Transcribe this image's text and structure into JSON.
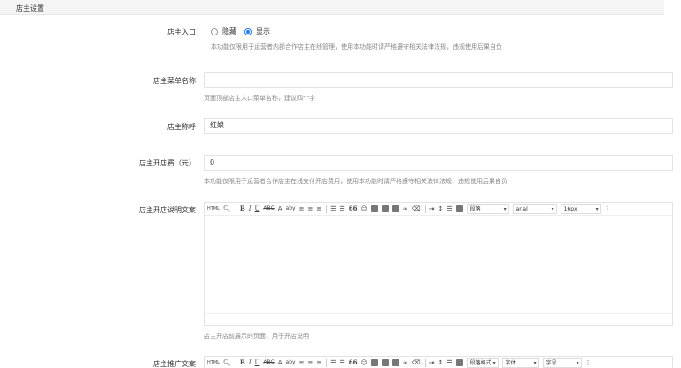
{
  "section": {
    "title": "店主设置"
  },
  "entry": {
    "label": "店主入口",
    "options": [
      {
        "label": "隐藏",
        "checked": false
      },
      {
        "label": "显示",
        "checked": true
      }
    ],
    "help": "本功能仅限用于运营者内部合作店主在线管理，使用本功能时请严格遵守相关法律法规，违规使用后果自负"
  },
  "menu_name": {
    "label": "店主菜单名称",
    "value": "",
    "help": "页面顶部店主入口菜单名称，建议四个字"
  },
  "title_field": {
    "label": "店主称呼",
    "value": "红娘"
  },
  "fee": {
    "label": "店主开店费（元）",
    "value": "0",
    "help": "本功能仅限用于运营者合作店主在线支付开店费用，使用本功能时请严格遵守相关法律法规，违规使用后果自负"
  },
  "desc_editor": {
    "label": "店主开店说明文案",
    "paragraph": "段落",
    "font": "arial",
    "size": "16px",
    "help": "店主开店前展示的页面，用于开店说明"
  },
  "promo_editor": {
    "label": "店主推广文案",
    "paragraph": "段落格式",
    "font": "字体",
    "size": "字号"
  },
  "toolbar": {
    "html": "HTML",
    "bold": "B",
    "italic": "I",
    "underline": "U",
    "strike": "ABC",
    "font_color": "A",
    "highlight": "aby",
    "quote": "66"
  }
}
